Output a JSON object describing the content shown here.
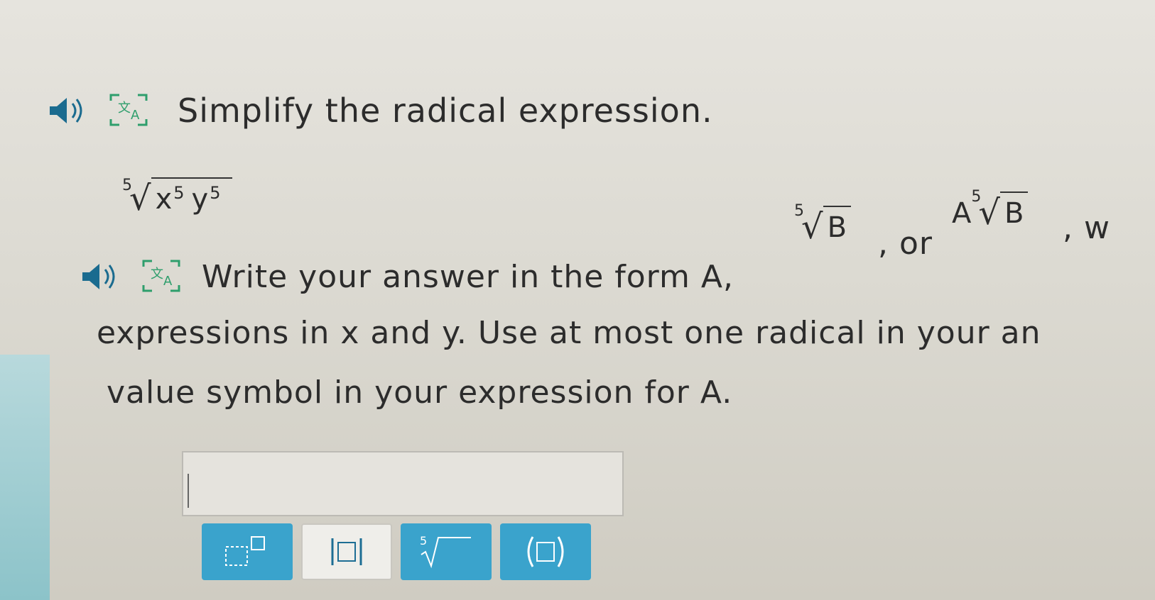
{
  "question": {
    "title": "Simplify the radical expression."
  },
  "expression": {
    "index": "5",
    "base1": "x",
    "exp1": "5",
    "base2": "y",
    "exp2": "5"
  },
  "instructions": {
    "line1_start": "Write your answer in the form A,",
    "form_index": "5",
    "form_radicand": "B",
    "or_text": ", or",
    "form_coef": "A",
    "trailing": ", w",
    "line2": "expressions in x and y. Use at most one radical in your an",
    "line3": "value symbol in your expression for A."
  },
  "answer": {
    "value": ""
  },
  "toolbar": {
    "buttons": [
      {
        "name": "superscript",
        "icon": "superscript-icon"
      },
      {
        "name": "absolute-value",
        "icon": "absolute-value-icon"
      },
      {
        "name": "fifth-root",
        "icon": "fifth-root-icon",
        "label": "5"
      },
      {
        "name": "parentheses",
        "icon": "parentheses-icon"
      }
    ]
  },
  "colors": {
    "accent_blue": "#3aa3cc",
    "icon_green": "#2e9e6c",
    "speaker_blue": "#1a6b8f"
  }
}
